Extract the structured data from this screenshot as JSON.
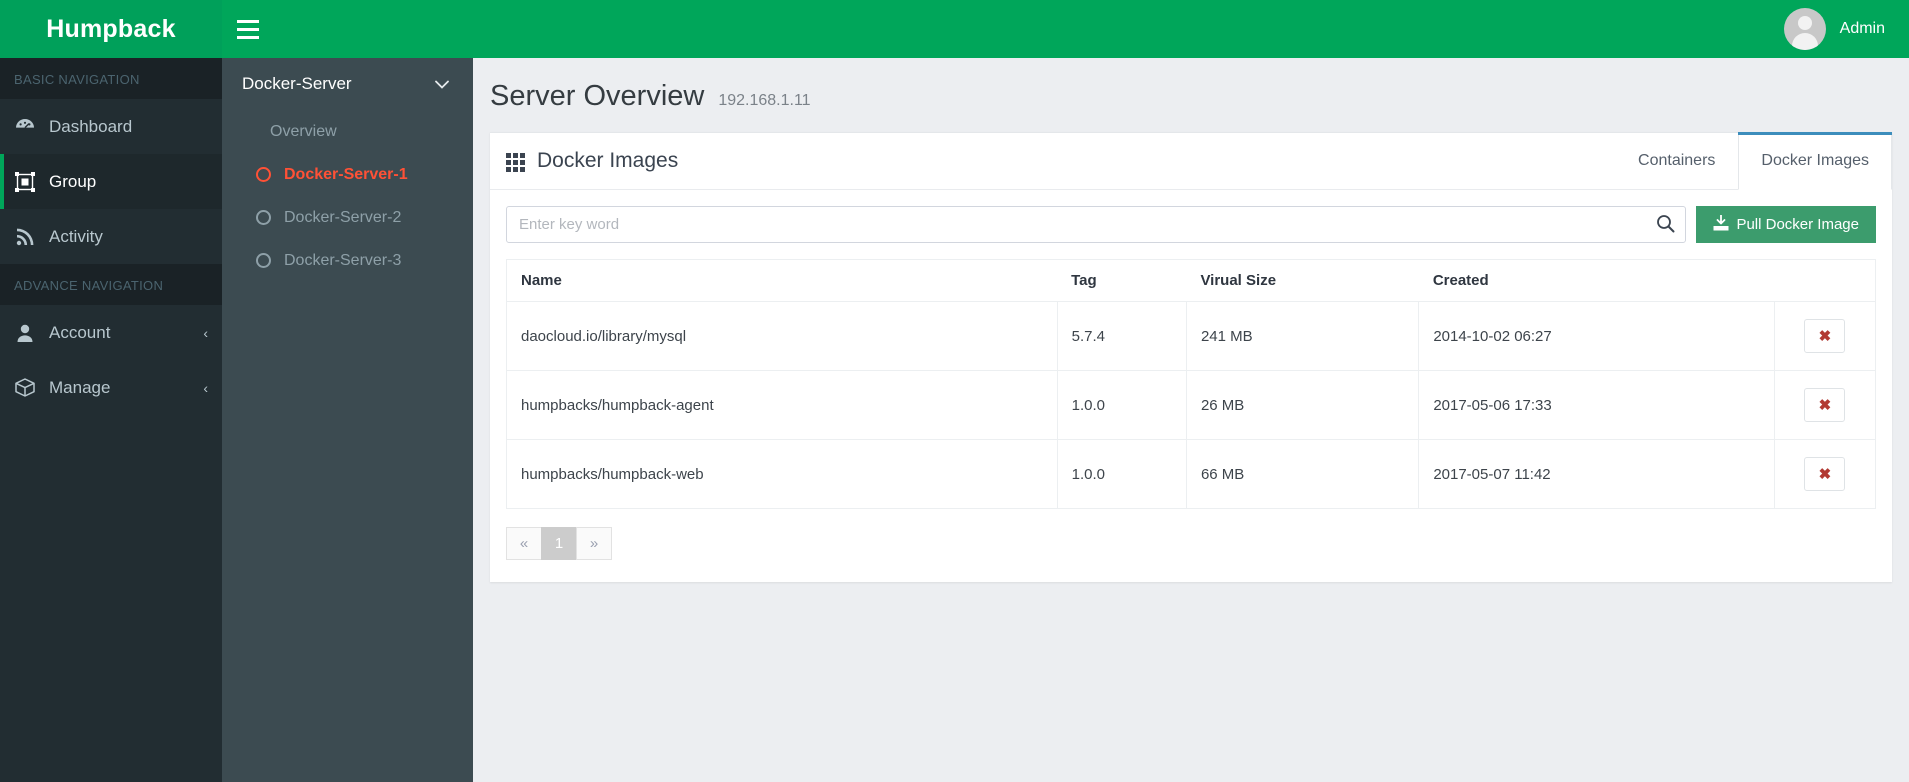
{
  "brand": {
    "name": "Humpback"
  },
  "topbar": {
    "menu_icon": "hamburger-icon",
    "user_name": "Admin",
    "avatar_icon": "user-avatar-icon"
  },
  "sidebar": {
    "sections": [
      {
        "header": "BASIC NAVIGATION",
        "items": [
          {
            "label": "Dashboard",
            "icon": "dashboard-icon",
            "active": false,
            "arrow": ""
          },
          {
            "label": "Group",
            "icon": "group-icon",
            "active": true,
            "arrow": ""
          },
          {
            "label": "Activity",
            "icon": "activity-rss-icon",
            "active": false,
            "arrow": ""
          }
        ]
      },
      {
        "header": "ADVANCE NAVIGATION",
        "items": [
          {
            "label": "Account",
            "icon": "user-icon",
            "active": false,
            "arrow": "‹"
          },
          {
            "label": "Manage",
            "icon": "box-icon",
            "active": false,
            "arrow": "‹"
          }
        ]
      }
    ]
  },
  "submenu": {
    "title": "Docker-Server",
    "chevron": "⌄",
    "items": [
      {
        "label": "Overview",
        "type": "plain",
        "active": false
      },
      {
        "label": "Docker-Server-1",
        "type": "dot",
        "active": true
      },
      {
        "label": "Docker-Server-2",
        "type": "dot",
        "active": false
      },
      {
        "label": "Docker-Server-3",
        "type": "dot",
        "active": false
      }
    ]
  },
  "page": {
    "title": "Server Overview",
    "subtitle": "192.168.1.11"
  },
  "panel": {
    "title": "Docker Images",
    "title_icon": "grid-th-icon",
    "tabs": [
      {
        "label": "Containers",
        "active": false
      },
      {
        "label": "Docker Images",
        "active": true
      }
    ],
    "active_tab_accent": "#3c8dbc"
  },
  "search": {
    "placeholder": "Enter key word",
    "value": "",
    "search_icon": "search-icon"
  },
  "actions": {
    "pull_label": "Pull Docker Image",
    "pull_icon": "download-icon",
    "pull_color": "#3c9c6d",
    "delete_icon": "close-x-icon",
    "delete_label": "✖"
  },
  "table": {
    "columns": [
      "Name",
      "Tag",
      "Virual Size",
      "Created",
      ""
    ],
    "rows": [
      {
        "name": "daocloud.io/library/mysql",
        "tag": "5.7.4",
        "size": "241 MB",
        "created": "2014-10-02 06:27"
      },
      {
        "name": "humpbacks/humpback-agent",
        "tag": "1.0.0",
        "size": "26 MB",
        "created": "2017-05-06 17:33"
      },
      {
        "name": "humpbacks/humpback-web",
        "tag": "1.0.0",
        "size": "66 MB",
        "created": "2017-05-07 11:42"
      }
    ]
  },
  "pagination": {
    "prev": "«",
    "next": "»",
    "pages": [
      "1"
    ],
    "current": "1"
  }
}
